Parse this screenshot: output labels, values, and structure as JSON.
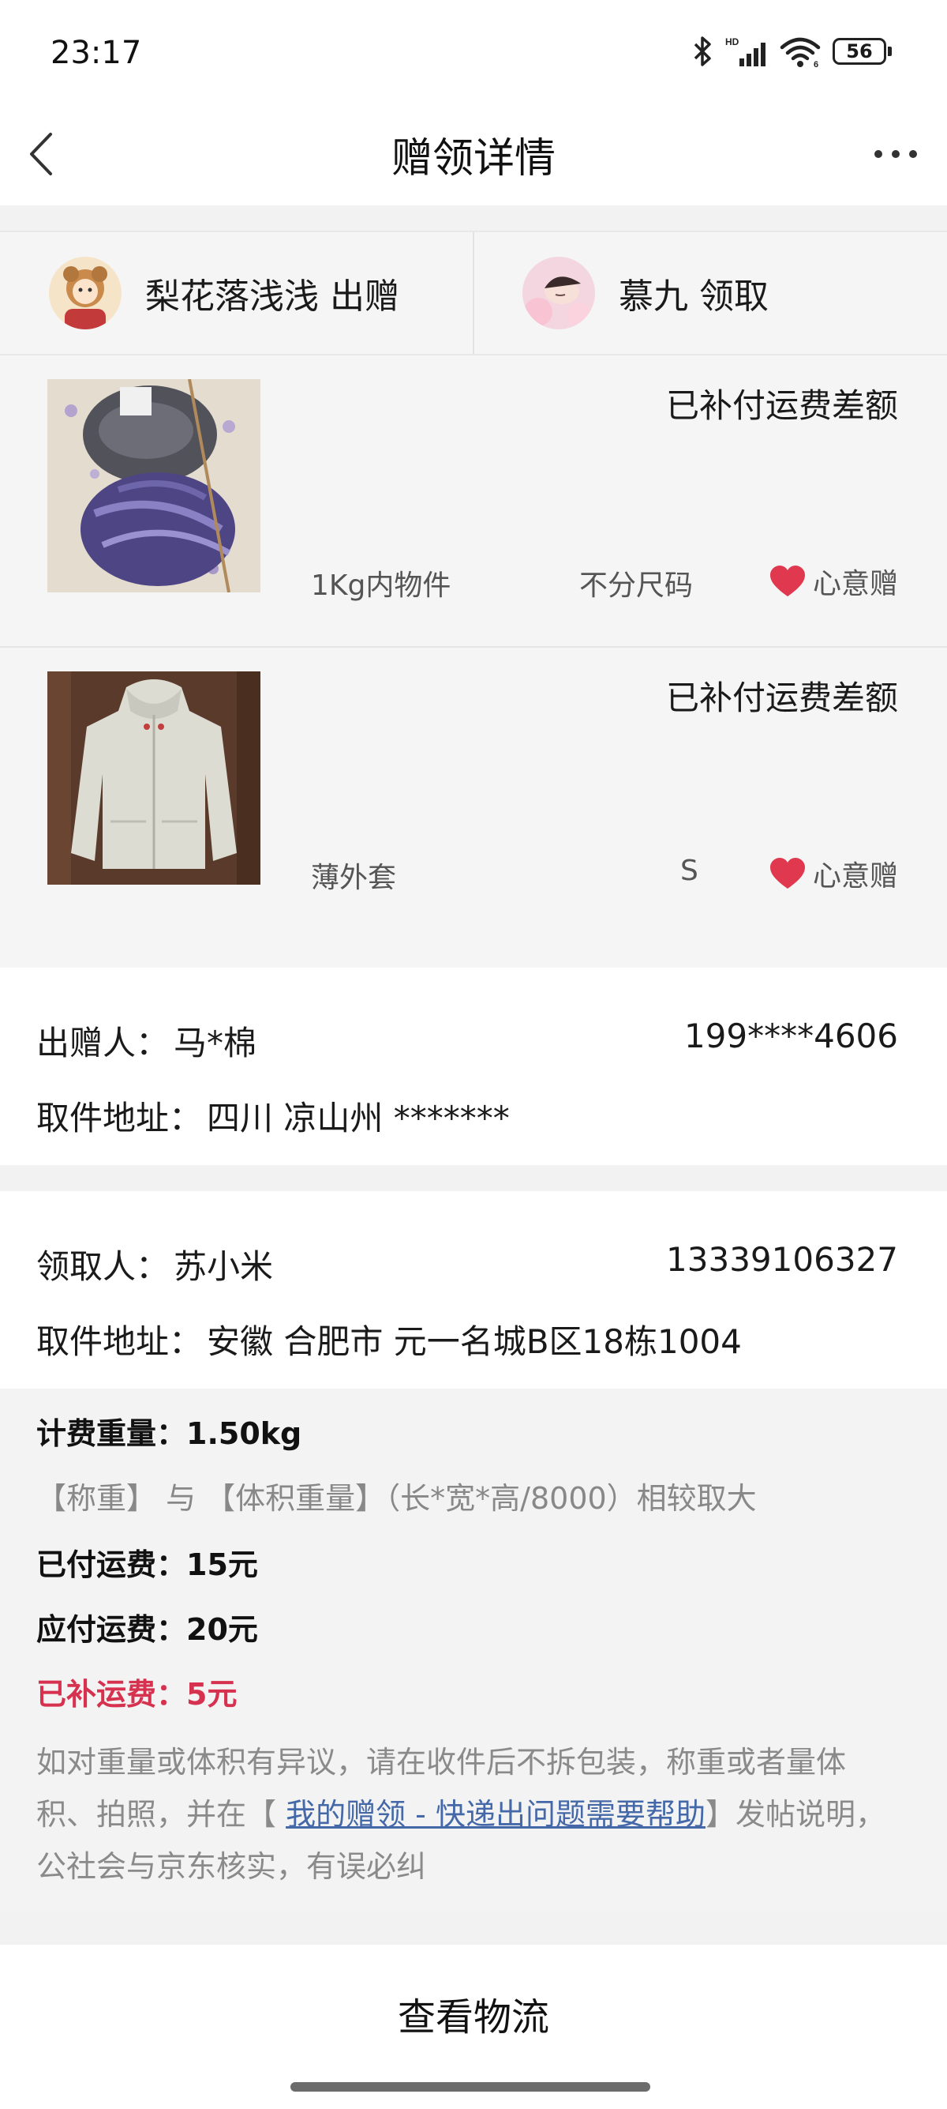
{
  "status_bar": {
    "time": "23:17",
    "battery": "56"
  },
  "nav": {
    "title": "赠领详情"
  },
  "parties": {
    "giver": {
      "name": "梨花落浅浅",
      "role": "出赠"
    },
    "receiver": {
      "name": "慕九",
      "role": "领取"
    }
  },
  "items": [
    {
      "status": "已补付运费差额",
      "name": "1Kg内物件",
      "size": "不分尺码",
      "tag": "心意赠"
    },
    {
      "status": "已补付运费差额",
      "name": "薄外套",
      "size": "S",
      "tag": "心意赠"
    }
  ],
  "giver_info": {
    "label": "出赠人：",
    "name": "马*棉",
    "phone": "199****4606",
    "address_label": "取件地址：",
    "address": "四川 凉山州 *******"
  },
  "receiver_info": {
    "label": "领取人：",
    "name": "苏小米",
    "phone": "13339106327",
    "address_label": "取件地址：",
    "address": "安徽 合肥市 元一名城B区18栋1004"
  },
  "fees": {
    "weight_label": "计费重量：",
    "weight": "1.50kg",
    "rule": "【称重】 与 【体积重量】（长*宽*高/8000）相较取大",
    "paid_label": "已付运费：",
    "paid": "15元",
    "due_label": "应付运费：",
    "due": "20元",
    "extra_label": "已补运费：",
    "extra": "5元",
    "note_prefix": "如对重量或体积有异议，请在收件后不拆包装，称重或者量体积、拍照，并在【 ",
    "note_link": "我的赠领 - 快递出问题需要帮助",
    "note_suffix": "】发帖说明，公社会与京东核实，有误必纠"
  },
  "bottom": {
    "logistics_label": "查看物流"
  },
  "colors": {
    "accent_red": "#d6324f",
    "link_blue": "#4468a8",
    "heart": "#e0394f"
  }
}
